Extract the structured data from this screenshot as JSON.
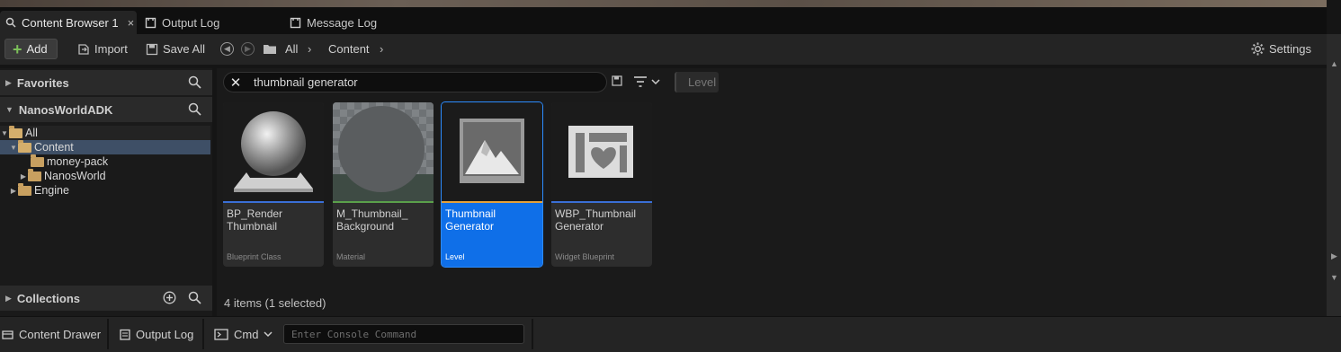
{
  "tabs": [
    {
      "label": "Content Browser 1",
      "close": "×",
      "icon": "content-browser-icon"
    },
    {
      "label": "Output Log",
      "icon": "output-log-icon"
    },
    {
      "label": "Message Log",
      "icon": "message-log-icon"
    }
  ],
  "toolbar": {
    "add_label": "Add",
    "import_label": "Import",
    "save_all_label": "Save All",
    "breadcrumb": [
      "All",
      "Content"
    ],
    "settings_label": "Settings"
  },
  "left": {
    "favorites_label": "Favorites",
    "project_label": "NanosWorldADK",
    "tree": [
      {
        "label": "All"
      },
      {
        "label": "Content"
      },
      {
        "label": "money-pack"
      },
      {
        "label": "NanosWorld"
      },
      {
        "label": "Engine"
      }
    ],
    "collections_label": "Collections"
  },
  "search": {
    "value": "thumbnail generator",
    "filter_chip": "Level"
  },
  "assets": [
    {
      "name": "BP_Render Thumbnail",
      "type": "Blueprint Class",
      "color": "#3a6fd6"
    },
    {
      "name": "M_Thumbnail_ Background",
      "type": "Material",
      "color": "#5aa04a"
    },
    {
      "name": "Thumbnail Generator",
      "type": "Level",
      "color": "#e5a13a",
      "selected": true
    },
    {
      "name": "WBP_Thumbnail Generator",
      "type": "Widget Blueprint",
      "color": "#3a6fd6"
    }
  ],
  "status": {
    "items_text": "4 items (1 selected)"
  },
  "bottom": {
    "content_drawer_label": "Content Drawer",
    "output_log_label": "Output Log",
    "cmd_label": "Cmd",
    "console_placeholder": "Enter Console Command"
  }
}
